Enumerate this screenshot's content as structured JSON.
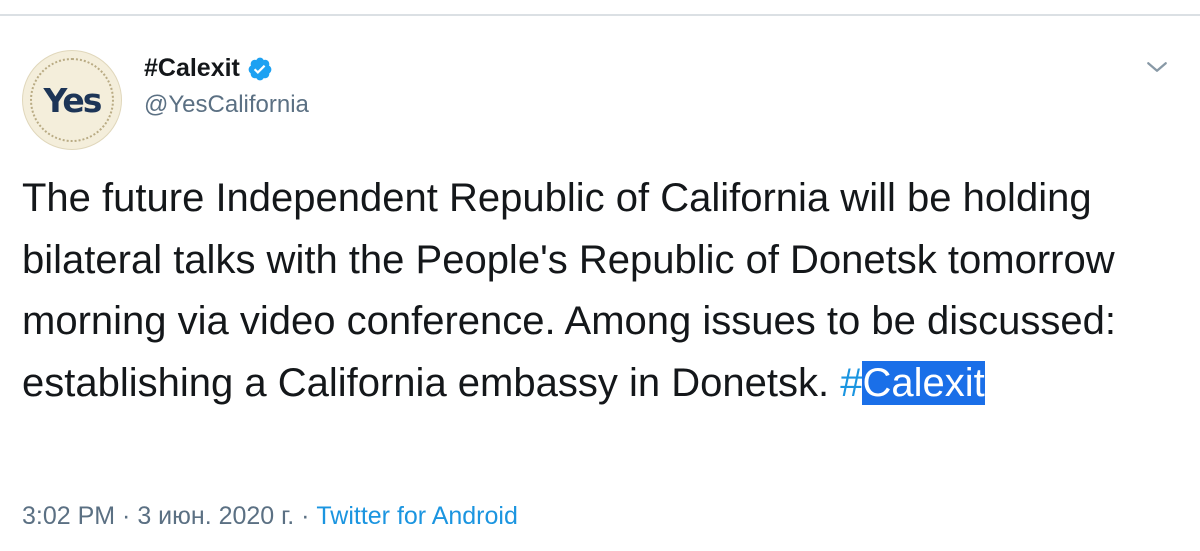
{
  "profile": {
    "avatar_text": "Yes",
    "display_name": "#Calexit",
    "handle": "@YesCalifornia",
    "verified": true
  },
  "tweet": {
    "text": "The future Independent Republic of California will be holding bilateral talks with the People's Republic of Donetsk tomorrow morning via video conference. Among issues to be discussed: establishing a California embassy in Donetsk. ",
    "hashtag_symbol": "#",
    "hashtag_word": "Calexit"
  },
  "meta": {
    "time": "3:02 PM",
    "separator_1": " · ",
    "date": "3 июн. 2020 г.",
    "separator_2": " · ",
    "source": "Twitter for Android"
  },
  "colors": {
    "link": "#1b95e0",
    "verified_badge": "#1da1f2",
    "secondary_text": "#5b7083",
    "selection_highlight": "#1a6fe8"
  },
  "icons": {
    "verified": "verified-badge-icon",
    "menu": "chevron-down-icon"
  }
}
